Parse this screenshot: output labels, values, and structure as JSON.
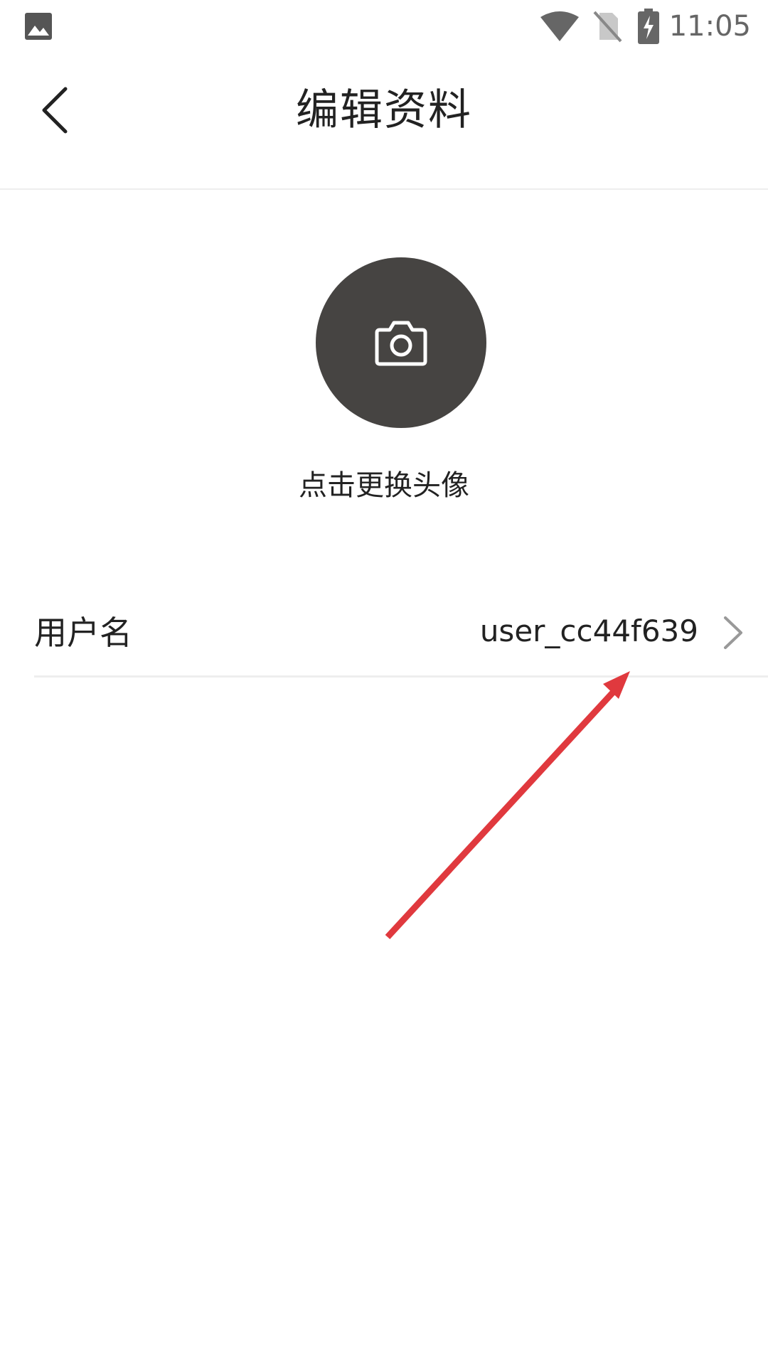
{
  "status_bar": {
    "time": "11:05",
    "icons": [
      "gallery-icon",
      "wifi-icon",
      "no-sim-icon",
      "battery-charging-icon"
    ]
  },
  "app_bar": {
    "title": "编辑资料",
    "back_icon": "chevron-left-icon"
  },
  "avatar": {
    "icon": "camera-icon",
    "hint": "点击更换头像"
  },
  "username_row": {
    "label": "用户名",
    "value": "user_cc44f639",
    "icon": "chevron-right-icon"
  },
  "colors": {
    "avatar_bg": "#464442",
    "annotation_arrow": "#e0393e",
    "divider": "#eeeeee"
  }
}
